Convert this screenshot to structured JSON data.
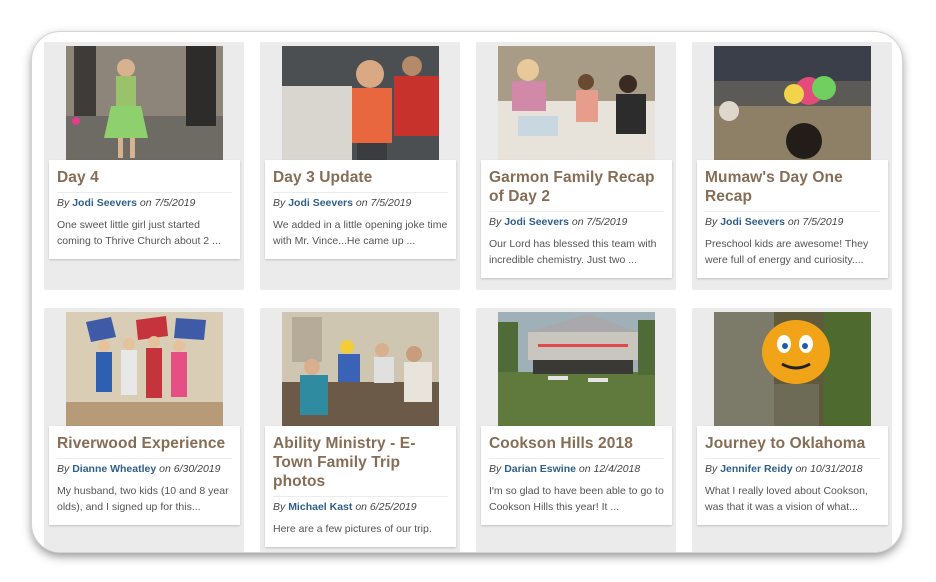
{
  "posts": [
    {
      "title": "Day 4",
      "by": "By",
      "author": "Jodi Seevers",
      "on": "on",
      "date": "7/5/2019",
      "excerpt": "One sweet little girl just started coming to Thrive Church about 2 ..."
    },
    {
      "title": "Day 3 Update",
      "by": "By",
      "author": "Jodi Seevers",
      "on": "on",
      "date": "7/5/2019",
      "excerpt": "We added in a little opening joke time with Mr. Vince...He came up ..."
    },
    {
      "title": "Garmon Family Recap of Day 2",
      "by": "By",
      "author": "Jodi Seevers",
      "on": "on",
      "date": "7/5/2019",
      "excerpt": "Our Lord has blessed this team with incredible chemistry. Just two ..."
    },
    {
      "title": "Mumaw's Day One Recap",
      "by": "By",
      "author": "Jodi Seevers",
      "on": "on",
      "date": "7/5/2019",
      "excerpt": "Preschool kids are awesome! They were full of energy and curiosity...."
    },
    {
      "title": "Riverwood Experience",
      "by": "By",
      "author": "Dianne Wheatley",
      "on": "on",
      "date": "6/30/2019",
      "excerpt": "My husband, two kids (10 and 8 year olds), and I signed up for this..."
    },
    {
      "title": "Ability Ministry - E-Town Family Trip photos",
      "by": "By",
      "author": "Michael Kast",
      "on": "on",
      "date": "6/25/2019",
      "excerpt": "Here are a few pictures of our trip."
    },
    {
      "title": "Cookson Hills 2018",
      "by": "By",
      "author": "Darian Eswine",
      "on": "on",
      "date": "12/4/2018",
      "excerpt": "I'm so glad to have been able to go to Cookson Hills this year! It ..."
    },
    {
      "title": "Journey to Oklahoma",
      "by": "By",
      "author": "Jennifer Reidy",
      "on": "on",
      "date": "10/31/2018",
      "excerpt": "What I really loved about Cookson, was that it was a vision of what..."
    }
  ]
}
